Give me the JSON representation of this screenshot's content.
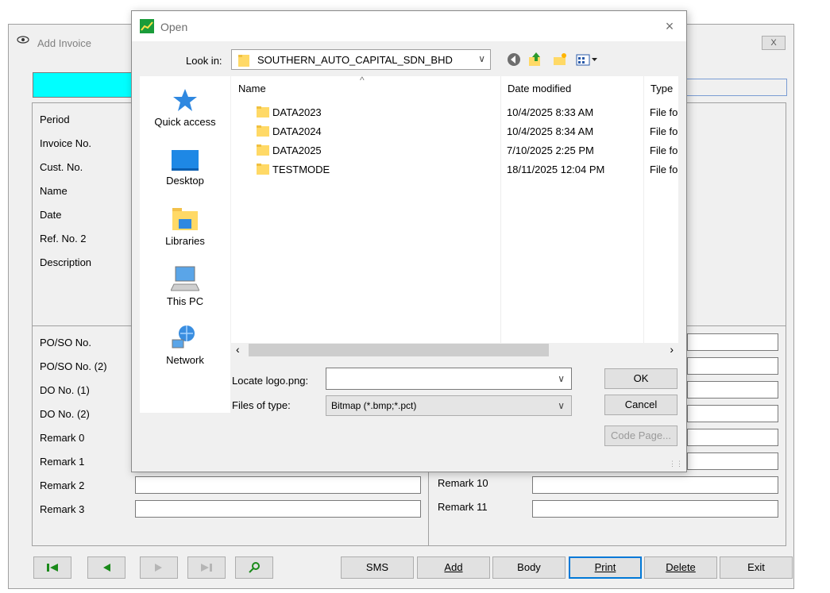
{
  "background_window": {
    "title": "Add Invoice",
    "close_label": "X",
    "header_labels": [
      "Period",
      "Invoice No.",
      "Cust. No.",
      "Name",
      "Date",
      "Ref. No. 2",
      "Description"
    ],
    "detail_labels": [
      "PO/SO No.",
      "PO/SO No. (2)",
      "DO No. (1)",
      "DO No. (2)",
      "Remark 0",
      "Remark 1",
      "Remark 2",
      "Remark 3"
    ],
    "right_labels": [
      "Remark 10",
      "Remark 11"
    ],
    "nav_buttons": [
      "first-record",
      "previous-record",
      "next-record",
      "last-record",
      "search-key"
    ],
    "action_buttons": [
      "SMS",
      "Add",
      "Body",
      "Print",
      "Delete",
      "Exit"
    ]
  },
  "dialog": {
    "title": "Open",
    "close_glyph": "×",
    "look_in_label": "Look in:",
    "look_in_value": "SOUTHERN_AUTO_CAPITAL_SDN_BHD",
    "places": [
      "Quick access",
      "Desktop",
      "Libraries",
      "This PC",
      "Network"
    ],
    "columns": {
      "name": "Name",
      "date": "Date modified",
      "type": "Type"
    },
    "files": [
      {
        "name": "DATA2023",
        "date": "10/4/2025 8:33 AM",
        "type": "File folder"
      },
      {
        "name": "DATA2024",
        "date": "10/4/2025 8:34 AM",
        "type": "File folder"
      },
      {
        "name": "DATA2025",
        "date": "7/10/2025 2:25 PM",
        "type": "File folder"
      },
      {
        "name": "TESTMODE",
        "date": "18/11/2025 12:04 PM",
        "type": "File folder"
      }
    ],
    "locate_label": "Locate logo.png:",
    "locate_value": "",
    "files_of_type_label": "Files of type:",
    "files_of_type_value": "Bitmap (*.bmp;*.pct)",
    "ok_label": "OK",
    "cancel_label": "Cancel",
    "code_page_label": "Code Page..."
  },
  "colors": {
    "cyan_field": "#00ffff",
    "focus_blue": "#0078d7"
  }
}
